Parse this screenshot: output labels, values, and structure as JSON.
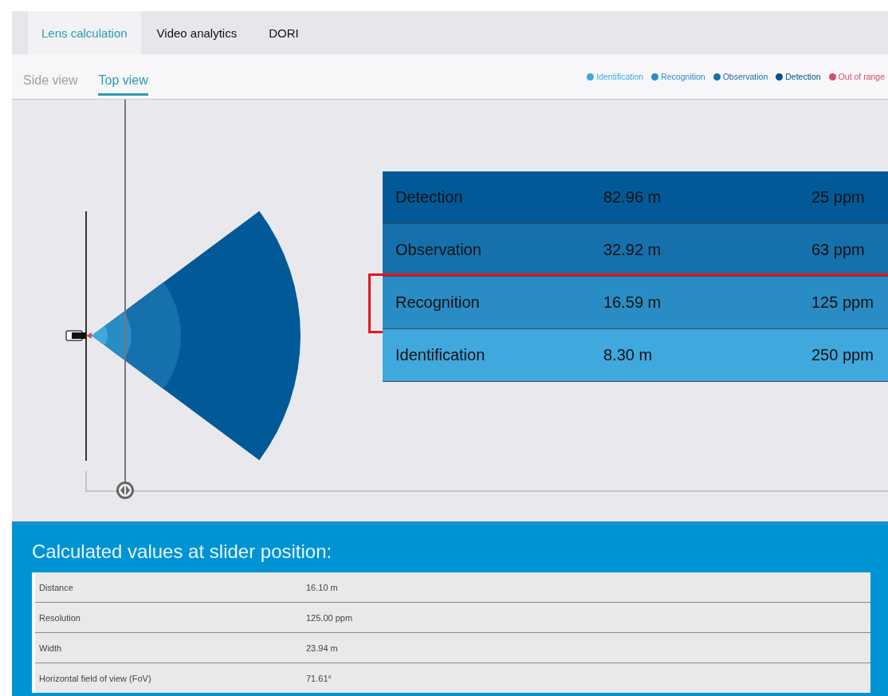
{
  "tabs": [
    {
      "label": "Lens calculation",
      "selected": true
    },
    {
      "label": "Video analytics",
      "selected": false
    },
    {
      "label": "DORI",
      "selected": false
    }
  ],
  "view_tabs": [
    {
      "label": "Side view",
      "selected": false
    },
    {
      "label": "Top view",
      "selected": true
    }
  ],
  "legend": [
    {
      "label": "Identification",
      "color": "#3fa8d8"
    },
    {
      "label": "Recognition",
      "color": "#2a8cc4"
    },
    {
      "label": "Observation",
      "color": "#1d6fa5"
    },
    {
      "label": "Detection",
      "color": "#00508a"
    },
    {
      "label": "Out of range",
      "color": "#d2506b"
    }
  ],
  "slider": {
    "level": 0.05
  },
  "dori_table": [
    {
      "name": "Detection",
      "distance": "82.96 m",
      "resolution": "25 ppm",
      "color": "#015a97",
      "highlighted": false
    },
    {
      "name": "Observation",
      "distance": "32.92 m",
      "resolution": "63 ppm",
      "color": "#1670ac",
      "highlighted": false
    },
    {
      "name": "Recognition",
      "distance": "16.59 m",
      "resolution": "125 ppm",
      "color": "#2a8cc4",
      "highlighted": true
    },
    {
      "name": "Identification",
      "distance": "8.30 m",
      "resolution": "250 ppm",
      "color": "#3fa8dc",
      "highlighted": false
    }
  ],
  "calculated": {
    "title": "Calculated values at slider position:",
    "rows": [
      {
        "label": "Distance",
        "value": "16.10 m"
      },
      {
        "label": "Resolution",
        "value": "125.00 ppm"
      },
      {
        "label": "Width",
        "value": "23.94 m"
      },
      {
        "label": "Horizontal field of view (FoV)",
        "value": "71.61°"
      }
    ]
  }
}
